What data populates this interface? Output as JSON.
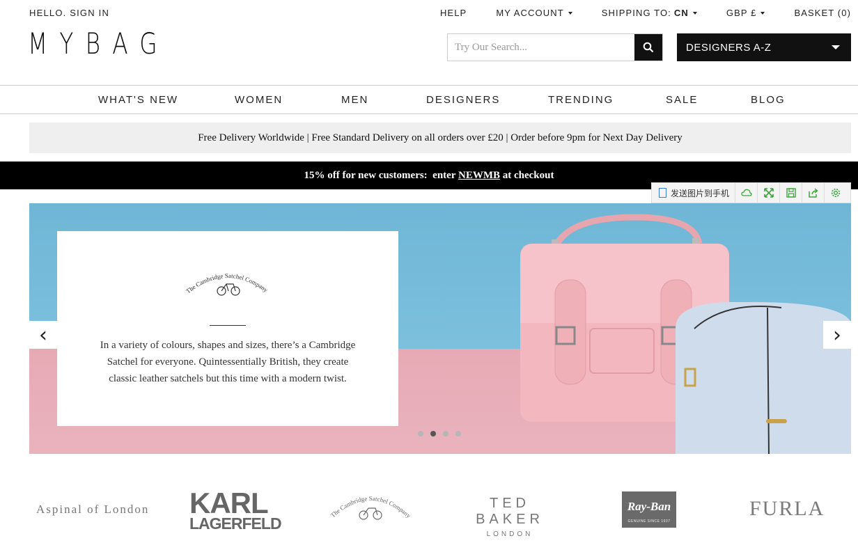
{
  "header": {
    "signin": "HELLO. SIGN IN",
    "logo": "MYBAG",
    "top_links": {
      "help": "HELP",
      "account": "MY ACCOUNT",
      "shipping_label": "SHIPPING TO:",
      "shipping_country": "CN",
      "currency": "GBP £",
      "basket": "BASKET (0)"
    },
    "search_placeholder": "Try Our Search...",
    "designers_dropdown": "DESIGNERS A-Z"
  },
  "nav": [
    "WHAT'S NEW",
    "WOMEN",
    "MEN",
    "DESIGNERS",
    "TRENDING",
    "SALE",
    "BLOG"
  ],
  "delivery_banner": "Free Delivery Worldwide | Free Standard Delivery on all orders over £20 | Order before 9pm for Next Day Delivery",
  "promo": {
    "before": "15% off for new customers:  enter ",
    "code": "NEWMB",
    "after": " at checkout"
  },
  "toolbar": {
    "send_label": "发送图片到手机",
    "icons": [
      "cloud-icon",
      "expand-icon",
      "save-icon",
      "share-icon",
      "settings-icon"
    ]
  },
  "hero": {
    "brand_logo_text": "The Cambridge Satchel Company",
    "description": "In a variety of colours, shapes and sizes, there’s a Cambridge Satchel for everyone. Quintessentially British, they create classic leather satchels but this time with a modern twist.",
    "slides": 4,
    "active_slide": 2
  },
  "brands": {
    "aspinal": "Aspinal of London",
    "karl_1": "KARL",
    "karl_2": "LAGERFELD",
    "cambridge": "The Cambridge Satchel Company",
    "ted_1": "TED BAKER",
    "ted_2": "LONDON",
    "rayban": "Ray-Ban",
    "rayban_sub": "GENUINE SINCE 1937",
    "furla": "FURLA"
  },
  "colors": {
    "accent": "#111111",
    "promo_bg": "#000000",
    "delivery_bg": "#efeff0",
    "hero_sky": "#7cc0dd",
    "hero_floor": "#e9b3bd"
  }
}
